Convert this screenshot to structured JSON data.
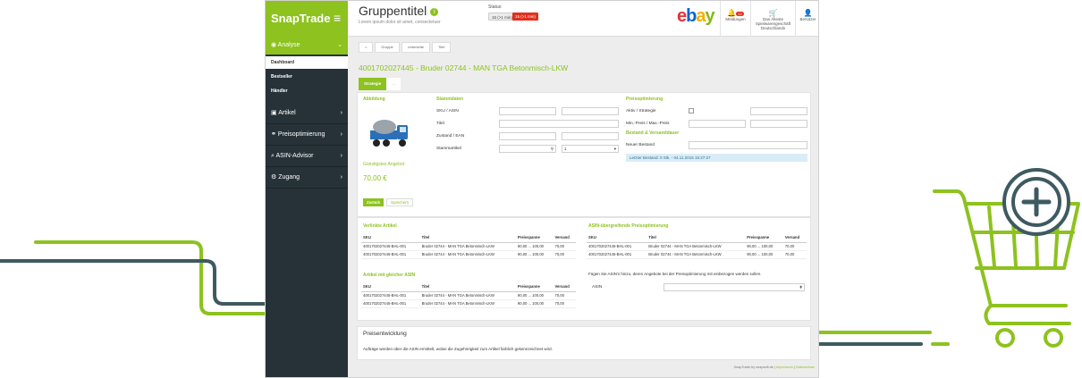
{
  "brand": {
    "name": "SnapTrade",
    "menu_icon": "hamburger-icon"
  },
  "header": {
    "title": "Gruppentitel",
    "subtitle": "Lorem ipsum dolor sit amet, consectetuer",
    "status_label": "Status:",
    "status_badge_1": "15 (>1 min)",
    "status_badge_2": "15 (>1 min)",
    "logo_letters": [
      "e",
      "b",
      "a",
      "y"
    ],
    "notifications_label": "Meldungen",
    "notifications_count": "12",
    "cart_label_1": "Das Älteste",
    "cart_label_2": "Spielwarengeschäft",
    "cart_label_3": "Deutschlands",
    "user_label": "Benutzer"
  },
  "sidebar": {
    "active_section": "Analyse",
    "subitems": [
      "Dashboard",
      "Bestseller",
      "Händler"
    ],
    "items": [
      {
        "label": "Artikel",
        "icon": "shopping-bag-icon"
      },
      {
        "label": "Preisoptimierung",
        "icon": "share-icon"
      },
      {
        "label": "ASIN-Advisor",
        "icon": "search-icon"
      },
      {
        "label": "Zugang",
        "icon": "gears-icon"
      }
    ]
  },
  "breadcrumb": [
    "Gruppe",
    "Unterseite",
    "Titel"
  ],
  "page_title": "4001702027445 - Bruder 02744 - MAN TGA Betonmisch-LKW",
  "tabs": [
    "Strategie",
    "..."
  ],
  "form": {
    "abbildung": "Abbildung",
    "stammdaten": "Stammdaten",
    "sku_label": "SKU / ASIN",
    "titel_label": "Titel",
    "zustand_label": "Zustand / EAN",
    "stammartikel_label": "Stammartikel",
    "stammartikel_select": "1",
    "preisopt": "Preisoptimierung",
    "aktiv_label": "Aktiv / Strategie",
    "minmax_label": "Min.-Preis / Max.-Preis",
    "bestand_section": "Bestand & Versanddauer",
    "neuer_bestand_label": "Neuer Bestand",
    "info": "Letzter Bestand: 0 Stk. - 04.11.2015 15:27:27",
    "guenstigstes_label": "Günstigstes Angebot",
    "price": "70,00 €",
    "btn_zurueck": "Zurück",
    "btn_speichern": "Speichern"
  },
  "verlinkte": {
    "title": "Verlinkte Artikel",
    "headers": [
      "SKU",
      "Titel",
      "Preisspanne",
      "Versand"
    ],
    "rows": [
      [
        "4001702027445-BHL-001",
        "Bruder 02744 - MAN TGA Betonmisch-LKW",
        "90,00 ... 100,00",
        "70,00"
      ],
      [
        "4001702027445-BHL-001",
        "Bruder 02744 - MAN TGA Betonmisch-LKW",
        "90,00 ... 100,00",
        "70,00"
      ]
    ]
  },
  "gleiche_asin": {
    "title": "Artikel mit gleicher ASIN",
    "headers": [
      "SKU",
      "Titel",
      "Preisspanne",
      "Versand"
    ],
    "rows": [
      [
        "4001702027445-BHL-001",
        "Bruder 02744 - MAN TGA Betonmisch-LKW",
        "90,00 ... 100,00",
        "70,00"
      ],
      [
        "4001702027445-BHL-001",
        "Bruder 02744 - MAN TGA Betonmisch-LKW",
        "90,00 ... 100,00",
        "70,00"
      ]
    ]
  },
  "asin_uebergreifend": {
    "title": "ASIN-übergreifende Preisoptimierung",
    "headers": [
      "SKU",
      "Titel",
      "Preisspanne",
      "Versand"
    ],
    "rows": [
      [
        "4001702027445-BHL-001",
        "Bruder 02744 - MAN TGA Betonmisch-LKW",
        "90,00 ... 100,00",
        "70,00"
      ],
      [
        "4001702027445-BHL-001",
        "Bruder 02744 - MAN TGA Betonmisch-LKW",
        "90,00 ... 100,00",
        "70,00"
      ]
    ],
    "note": "Fügen Sie ASIN's hinzu, deren Angebote bei der Preisoptimierung mit einbezogen werden sollen.",
    "asin_label": "ASIN"
  },
  "preisentwicklung": {
    "title": "Preisentwicklung",
    "text": "Aufträge werden über die ASIN ermittelt, wobei die Zugehörigkeit zum Artikel farblich gekennzeichnet wird."
  },
  "footer": {
    "text": "SnapTrade by snapsoft.de |",
    "impressum": "Impressum",
    "datenschutz": "Datenschutz"
  },
  "colors": {
    "accent": "#8dc21f",
    "dark": "#263238",
    "deco_line": "#3d5a60"
  }
}
